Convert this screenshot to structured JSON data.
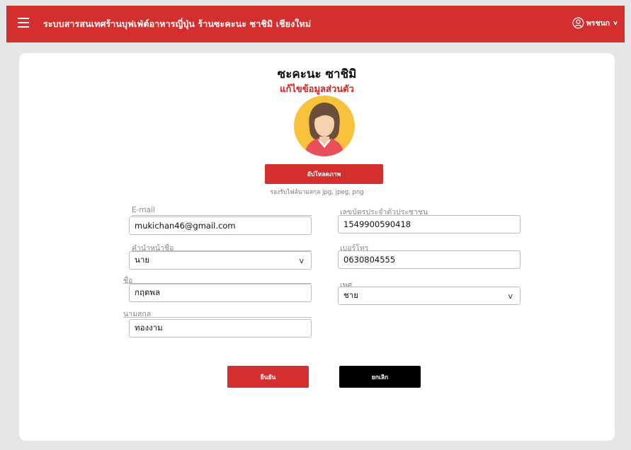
{
  "header": {
    "title": "ระบบสารสนเทศร้านบุฟเฟ่ต์อาหารญี่ปุ่น ร้านซะคะนะ ซาชิมิ เชียงใหม่",
    "user_name": "พรชนก",
    "user_chevron": "v",
    "menu_icon": "hamburger-menu-icon",
    "user_icon": "user-circle-icon",
    "bar_color": "#d32f2f"
  },
  "profile": {
    "shop_name": "ซะคะนะ ซาชิมิ",
    "subtitle": "แก้ไขข้อมูลส่วนตัว",
    "avatar_icon": "female-avatar-icon",
    "upload_label": "อัปโหลดภาพ",
    "upload_hint": "รองรับไฟล์นามสกุล  jpg, jpeg, png"
  },
  "form": {
    "email": {
      "label": "E-mail",
      "value": "mukichan46@gmail.com"
    },
    "title_prefix": {
      "label": "คำนำหน้าชื่อ",
      "value": "นาย",
      "chevron": "v"
    },
    "first_name": {
      "label": "ชื่อ",
      "value": "กฤตพล"
    },
    "last_name": {
      "label": "นามสกุล",
      "value": "ทองงาม"
    },
    "id_card": {
      "label": "เลขบัตรประจำตัวประชาชน",
      "value": "1549900590418"
    },
    "phone": {
      "label": "เบอร์โทร",
      "value": "0630804555"
    },
    "gender": {
      "label": "เพศ",
      "value": "ชาย",
      "chevron": "v"
    }
  },
  "actions": {
    "confirm_label": "ยืนยัน",
    "cancel_label": "ยกเลิก",
    "confirm_color": "#d32f2f",
    "cancel_color": "#000000"
  }
}
